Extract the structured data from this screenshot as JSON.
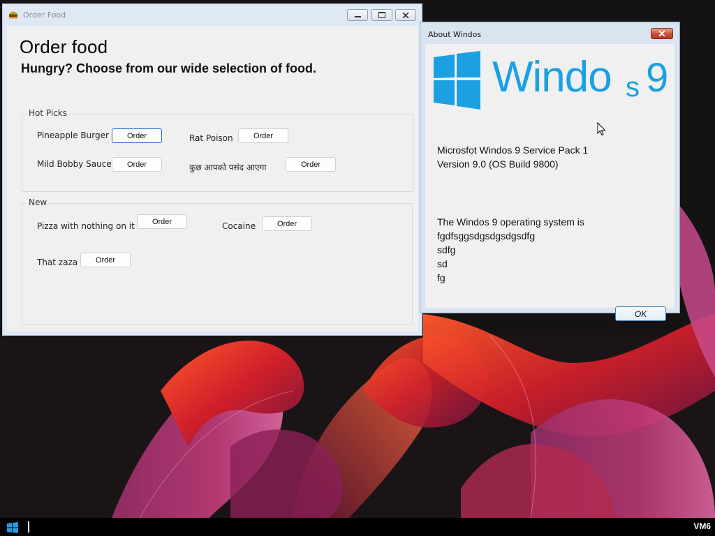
{
  "colors": {
    "window_frame": "#dfe9f5",
    "client_bg": "#f0f0f0",
    "focus_blue": "#1e6fc9",
    "windows_logo_blue": "#1ba1e2",
    "close_red": "#c9513a",
    "taskbar": "#000000"
  },
  "order_window": {
    "title": "Order Food",
    "icon": "burger-icon",
    "heading": "Order food",
    "subheading": "Hungry? Choose from our wide selection of food.",
    "hot_picks": {
      "legend": "Hot Picks",
      "items": [
        {
          "label": "Pineapple Burger",
          "button": "Order"
        },
        {
          "label": "Rat Poison",
          "button": "Order"
        },
        {
          "label": "Mild Bobby Sauce",
          "button": "Order"
        },
        {
          "label": "कुछ आपको पसंद आएगा",
          "button": "Order"
        }
      ]
    },
    "new": {
      "legend": "New",
      "items": [
        {
          "label": "Pizza with nothing on it",
          "button": "Order"
        },
        {
          "label": "Cocaine",
          "button": "Order"
        },
        {
          "label": "That zaza",
          "button": "Order"
        }
      ]
    }
  },
  "about_window": {
    "title": "About Windos",
    "logo_text_left": "Windo",
    "logo_text_right": "s",
    "logo_number": "9",
    "line1": "Microsfot Windos 9 Service Pack 1",
    "line2": "Version 9.0 (OS Build 9800)",
    "desc": "The Windos 9 operating system is",
    "desc_lines": [
      "fgdfsggsdgsdgsdgsdfg",
      "sdfg",
      "sd",
      "fg"
    ],
    "ok_button": "OK"
  },
  "taskbar": {
    "label": "VM6",
    "start_icon": "windows-start-icon"
  }
}
